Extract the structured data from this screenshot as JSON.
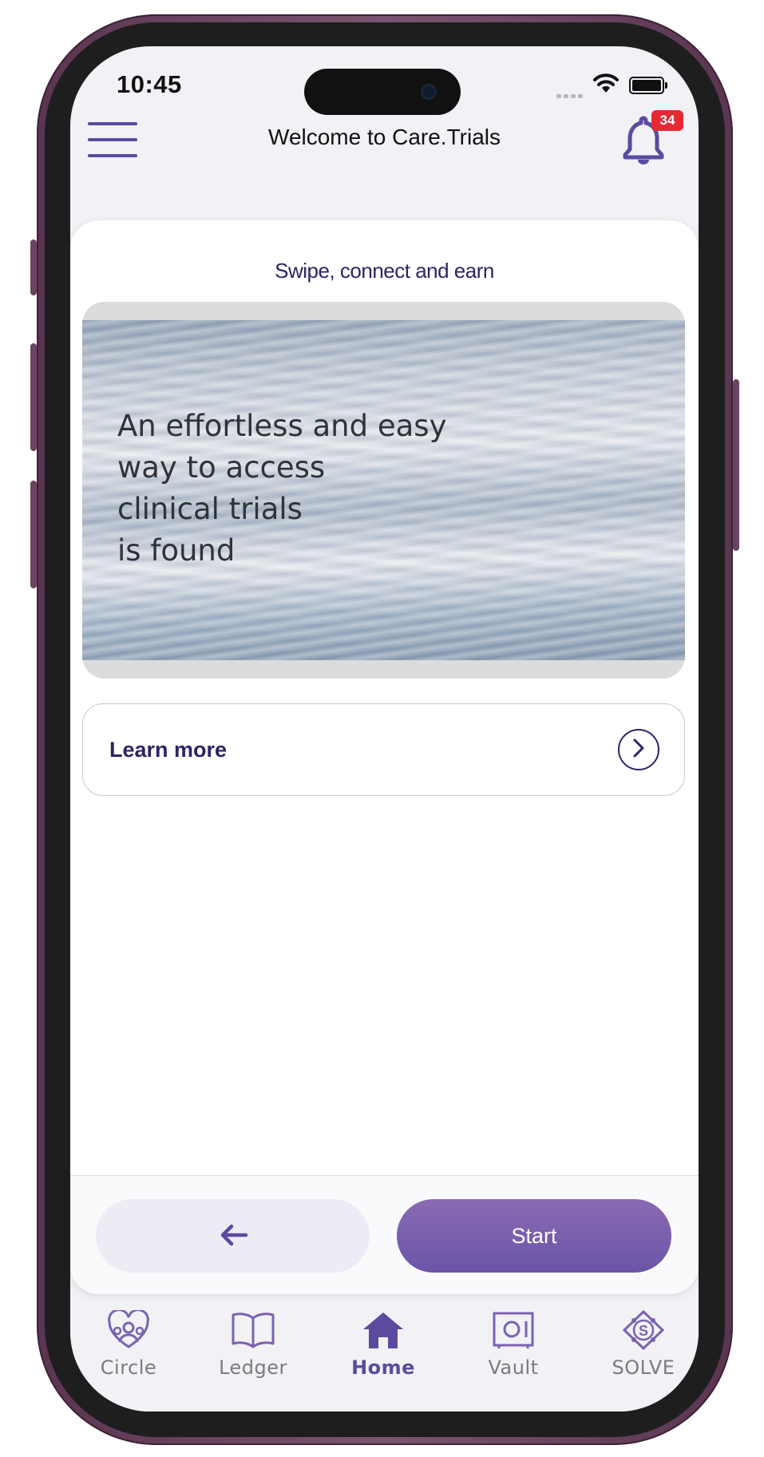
{
  "status_bar": {
    "time": "10:45"
  },
  "header": {
    "title": "Welcome to Care.Trials",
    "notification_count": "34"
  },
  "card": {
    "title": "Swipe, connect and earn",
    "hero": {
      "line1": "An effortless and easy",
      "line2": "way to access",
      "line3": "clinical trials",
      "line4": "is found"
    },
    "learn_more_label": "Learn more",
    "start_label": "Start"
  },
  "tabs": [
    {
      "label": "Circle",
      "icon": "circle-people-icon"
    },
    {
      "label": "Ledger",
      "icon": "book-icon"
    },
    {
      "label": "Home",
      "icon": "home-icon",
      "active": true
    },
    {
      "label": "Vault",
      "icon": "vault-icon"
    },
    {
      "label": "SOLVE",
      "icon": "solve-icon"
    }
  ],
  "colors": {
    "accent": "#5b4aa0",
    "primary_text": "#2d2466",
    "badge": "#e52a35",
    "back_button_bg": "#eeebf5"
  }
}
